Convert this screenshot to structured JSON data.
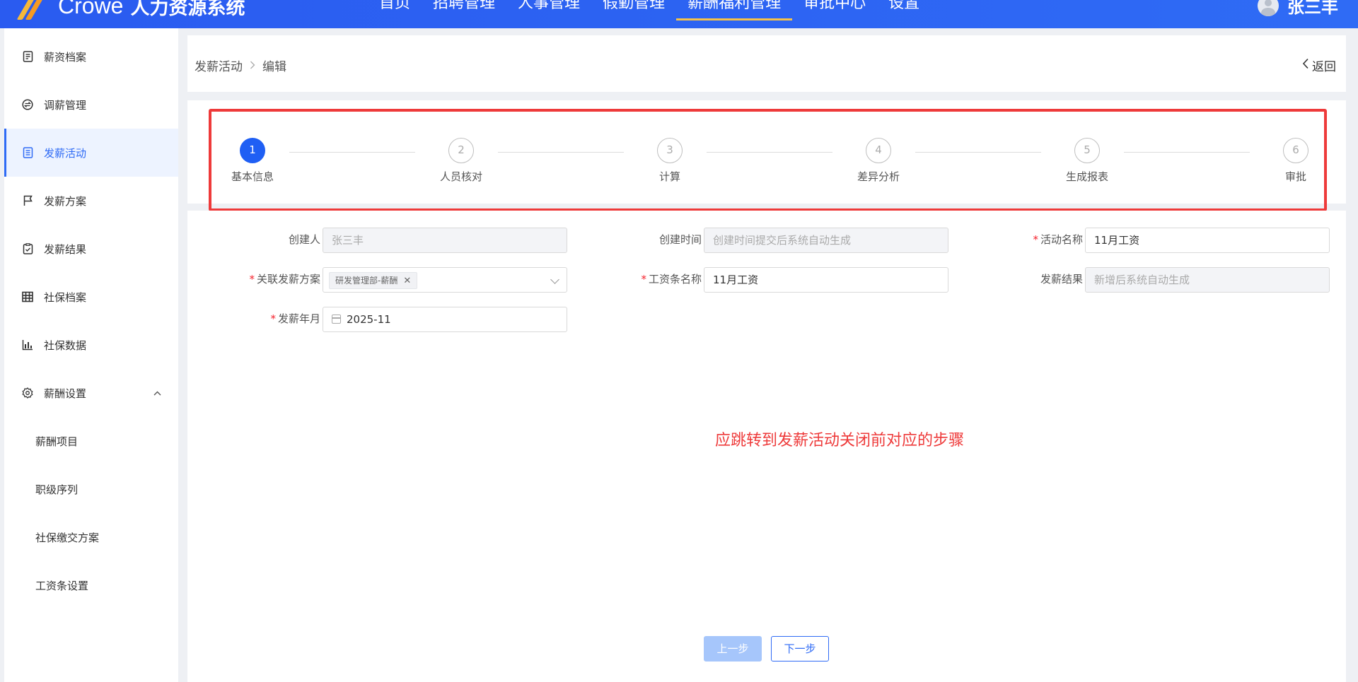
{
  "header": {
    "brand": "Crowe",
    "system_name": "人力资源系统",
    "nav": [
      {
        "label": "首页"
      },
      {
        "label": "招聘管理"
      },
      {
        "label": "人事管理"
      },
      {
        "label": "假勤管理"
      },
      {
        "label": "薪酬福利管理"
      },
      {
        "label": "审批中心"
      },
      {
        "label": "设置"
      }
    ],
    "active_nav": "薪酬福利管理",
    "user_name": "张三丰"
  },
  "sidebar": {
    "items": [
      {
        "label": "薪资档案",
        "icon": "file-icon"
      },
      {
        "label": "调薪管理",
        "icon": "exchange-icon"
      },
      {
        "label": "发薪活动",
        "icon": "document-icon"
      },
      {
        "label": "发薪方案",
        "icon": "flag-icon"
      },
      {
        "label": "发薪结果",
        "icon": "clipboard-check-icon"
      },
      {
        "label": "社保档案",
        "icon": "grid-icon"
      },
      {
        "label": "社保数据",
        "icon": "bar-chart-icon"
      },
      {
        "label": "薪酬设置",
        "icon": "gear-icon"
      },
      {
        "label": "薪酬项目"
      },
      {
        "label": "职级序列"
      },
      {
        "label": "社保缴交方案"
      },
      {
        "label": "工资条设置"
      }
    ],
    "active": "发薪活动"
  },
  "breadcrumb": {
    "parent": "发薪活动",
    "current": "编辑",
    "back_label": "返回"
  },
  "steps": [
    {
      "num": "1",
      "label": "基本信息"
    },
    {
      "num": "2",
      "label": "人员核对"
    },
    {
      "num": "3",
      "label": "计算"
    },
    {
      "num": "4",
      "label": "差异分析"
    },
    {
      "num": "5",
      "label": "生成报表"
    },
    {
      "num": "6",
      "label": "审批"
    }
  ],
  "active_step": 1,
  "form": {
    "creator": {
      "label": "创建人",
      "value": "张三丰"
    },
    "created_time": {
      "label": "创建时间",
      "placeholder": "创建时间提交后系统自动生成"
    },
    "activity_name": {
      "label": "活动名称",
      "value": "11月工资"
    },
    "plan": {
      "label": "关联发薪方案",
      "tag": "研发管理部-薪酬"
    },
    "payslip_name": {
      "label": "工资条名称",
      "value": "11月工资"
    },
    "result": {
      "label": "发薪结果",
      "placeholder": "新增后系统自动生成"
    },
    "pay_month": {
      "label": "发薪年月",
      "value": "2025-11"
    }
  },
  "annotation": "应跳转到发薪活动关闭前对应的步骤",
  "buttons": {
    "prev": "上一步",
    "next": "下一步"
  },
  "colors": {
    "primary": "#2f6bf5",
    "highlight_border": "#ee3a3a",
    "required": "#f5222d"
  }
}
